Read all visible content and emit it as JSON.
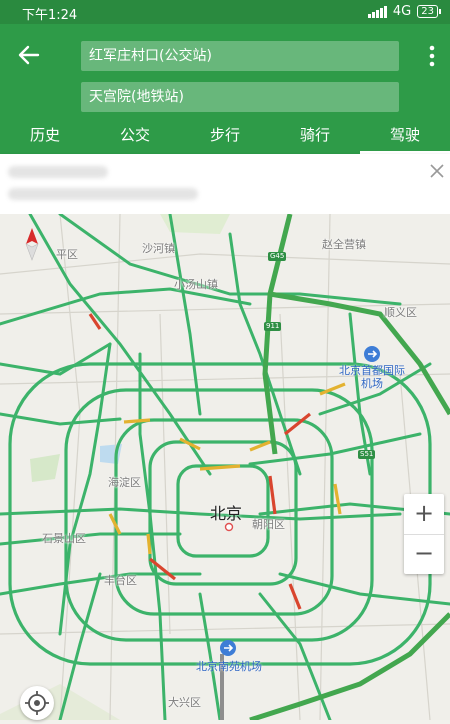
{
  "status_bar": {
    "time": "下午1:24",
    "network": "4G",
    "battery": "23"
  },
  "route": {
    "start": "红军庄村口(公交站)",
    "end": "天宫院(地铁站)"
  },
  "tabs": [
    {
      "label": "历史",
      "active": false
    },
    {
      "label": "公交",
      "active": false
    },
    {
      "label": "步行",
      "active": false
    },
    {
      "label": "骑行",
      "active": false
    },
    {
      "label": "驾驶",
      "active": true
    }
  ],
  "map": {
    "city": "北京",
    "labels": {
      "changping": "平区",
      "shahe": "沙河镇",
      "xiaotangshan": "小汤山镇",
      "zhaoquanying": "赵全营镇",
      "shunyi": "顺义区",
      "haidian": "海淀区",
      "shijingshan": "石景山区",
      "fengtai": "丰台区",
      "chaoyang": "朝阳区",
      "daxing": "大兴区",
      "shunyi_west": "顺义区"
    },
    "airports": {
      "capital": "北京首都国际机场",
      "nanyuan": "北京南苑机场"
    },
    "shields": {
      "g45": "G45",
      "g1": "911",
      "s51": "S51"
    }
  },
  "controls": {
    "zoom_in": "+",
    "zoom_out": "−"
  },
  "colors": {
    "header": "#2e9b48",
    "road": "#3cb36a",
    "congestion": "#e3b230",
    "jam": "#d9452e",
    "ring": "#43a74f"
  }
}
